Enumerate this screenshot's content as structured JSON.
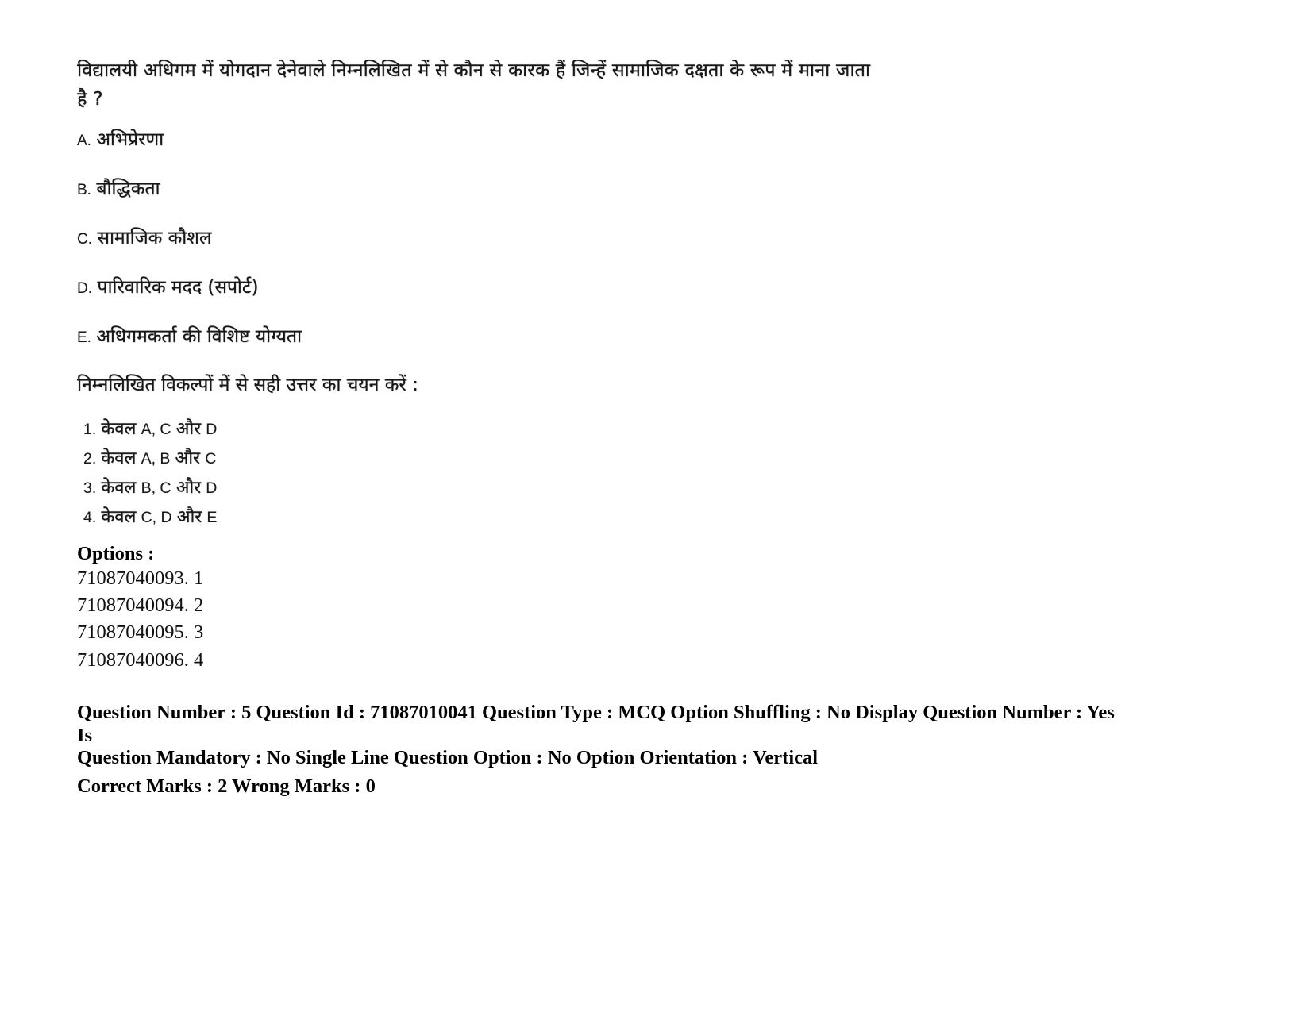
{
  "question": {
    "stem": "विद्यालयी अधिगम में योगदान देनेवाले निम्नलिखित में से कौन से कारक हैं जिन्हें सामाजिक दक्षता के रूप में माना जाता है ?",
    "statements": [
      {
        "label": "A.",
        "text": "अभिप्रेरणा"
      },
      {
        "label": "B.",
        "text": "बौद्धिकता"
      },
      {
        "label": "C.",
        "text": "सामाजिक कौशल"
      },
      {
        "label": "D.",
        "text": "पारिवारिक मदद (सपोर्ट)"
      },
      {
        "label": "E.",
        "text": "अधिगमकर्ता की विशिष्ट योग्यता"
      }
    ],
    "instruction": "निम्नलिखित विकल्पों में से सही उत्तर का चयन करें :",
    "choices": [
      {
        "num": "1.",
        "prefix": "केवल",
        "letters": "A, C",
        "conj": "और",
        "last": "D"
      },
      {
        "num": "2.",
        "prefix": "केवल",
        "letters": "A, B",
        "conj": "और",
        "last": "C"
      },
      {
        "num": "3.",
        "prefix": "केवल",
        "letters": "B, C",
        "conj": "और",
        "last": "D"
      },
      {
        "num": "4.",
        "prefix": "केवल",
        "letters": "C, D",
        "conj": "और",
        "last": "E"
      }
    ]
  },
  "options_section": {
    "heading": "Options :",
    "items": [
      "71087040093. 1",
      "71087040094. 2",
      "71087040095. 3",
      "71087040096. 4"
    ]
  },
  "metadata": {
    "line1": "Question Number : 5 Question Id : 71087010041 Question Type : MCQ Option Shuffling : No Display Question Number : Yes Is",
    "line2": "Question Mandatory : No Single Line Question Option : No Option Orientation : Vertical",
    "line3": "Correct Marks : 2 Wrong Marks : 0"
  }
}
